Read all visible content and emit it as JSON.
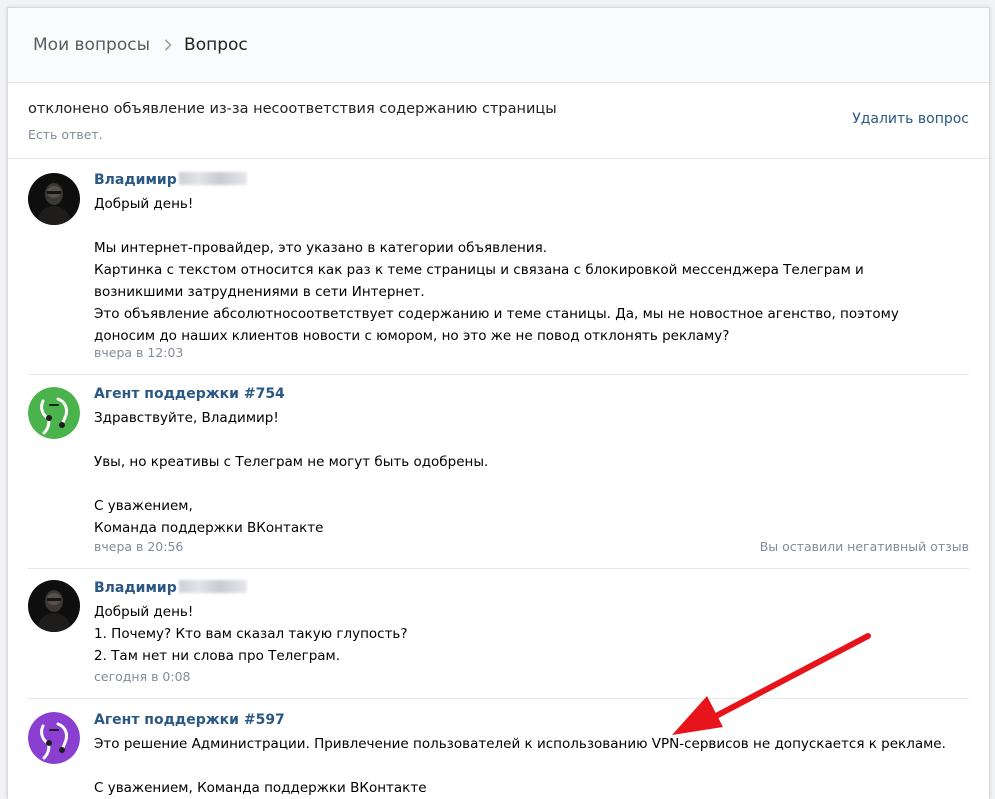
{
  "breadcrumb": {
    "parent": "Мои вопросы",
    "current": "Вопрос"
  },
  "question": {
    "title": "отклонено объявление из-за несоответствия содержанию страницы",
    "status": "Есть ответ.",
    "delete_label": "Удалить вопрос"
  },
  "messages": [
    {
      "author": "Владимир",
      "text": "Добрый день!\n\nМы интернет-провайдер, это указано в категории объявления.\nКартинка с текстом относится как раз к теме страницы и связана с блокировкой мессенджера Телеграм и\nвозникшими затруднениями в сети Интернет.\nЭто объявление абсолютносоответствует содержанию и теме станицы. Да, мы не новостное агенство, поэтому\nдоносим до наших клиентов новости с юмором, но это же не повод отклонять рекламу?",
      "time": "вчера в 12:03"
    },
    {
      "author": "Агент поддержки #754",
      "text": "Здравствуйте, Владимир!\n\nУвы, но креативы с Телеграм не могут быть одобрены.\n\nС уважением,\nКоманда поддержки ВКонтакте",
      "time": "вчера в 20:56",
      "feedback": "Вы оставили негативный отзыв"
    },
    {
      "author": "Владимир",
      "text": "Добрый день!\n1. Почему? Кто вам сказал такую глупость?\n2. Там нет ни слова про Телеграм.",
      "time": "сегодня в 0:08"
    },
    {
      "author": "Агент поддержки #597",
      "text": "Это решение Администрации. Привлечение пользователей к использованию VPN-сервисов не допускается к рекламе.\n\nС уважением, Команда поддержки ВКонтакте"
    }
  ],
  "colors": {
    "link": "#2a5885",
    "muted": "#818c99",
    "agent_green": "#4bb34b",
    "agent_purple": "#8b3fd1",
    "arrow_red": "#e8141c"
  },
  "icons": {
    "breadcrumb_separator": "chevron-right-icon",
    "annotation": "red-arrow"
  }
}
